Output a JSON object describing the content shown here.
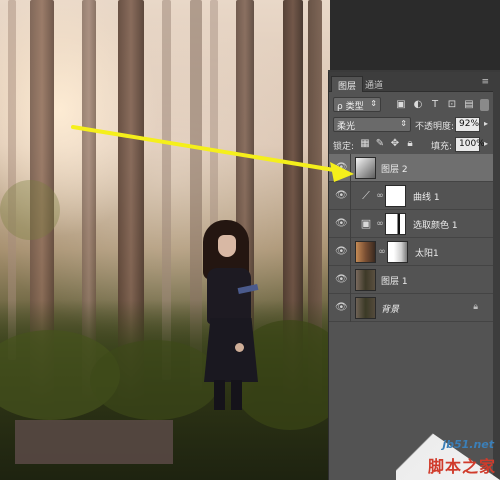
{
  "panel": {
    "tabs": [
      "图层",
      "通道"
    ],
    "menu_icons": [
      "collapse-icon",
      "panel-menu-icon"
    ],
    "filter": {
      "label": "ρ 类型",
      "options_icon": "chevron-down-icon"
    },
    "filter_icons": [
      "image-filter-icon",
      "adjustment-filter-icon",
      "type-filter-icon",
      "shape-filter-icon",
      "smart-object-filter-icon"
    ],
    "blend_mode": "柔光",
    "opacity_label": "不透明度:",
    "opacity_value": "92%",
    "lock_label": "锁定:",
    "lock_icons": [
      "lock-transparent-icon",
      "lock-paint-icon",
      "lock-move-icon",
      "lock-all-icon"
    ],
    "fill_label": "填充:",
    "fill_value": "100%"
  },
  "layers": [
    {
      "name": "图层 2",
      "type": "pixel",
      "selected": true
    },
    {
      "name": "曲线 1",
      "type": "adjustment-curves",
      "selected": false
    },
    {
      "name": "选取颜色 1",
      "type": "adjustment-selective-color",
      "selected": false
    },
    {
      "name": "太阳1",
      "type": "pixel-with-mask",
      "selected": false
    },
    {
      "name": "图层 1",
      "type": "pixel",
      "selected": false
    },
    {
      "name": "背景",
      "type": "background",
      "locked": true,
      "selected": false
    }
  ],
  "watermark": {
    "url": "jb51.net",
    "name": "脚本之家"
  },
  "colors": {
    "arrow": "#f5ef1b",
    "panel_bg": "#535353",
    "selected_row": "#6f6f6f"
  }
}
